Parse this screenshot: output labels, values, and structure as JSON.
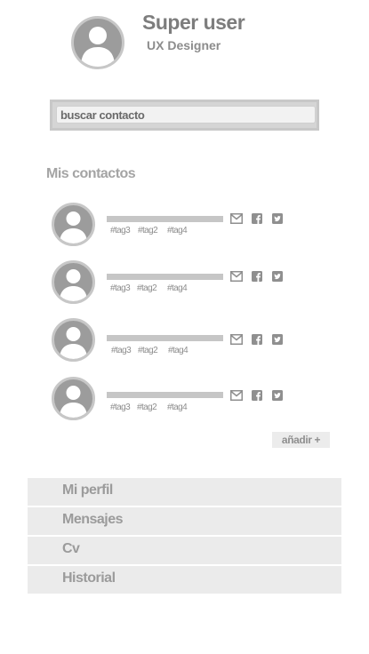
{
  "profile": {
    "name": "Super user",
    "role": "UX Designer",
    "avatar_icon": "user-silhouette-icon"
  },
  "search": {
    "value": "buscar contacto",
    "placeholder": "buscar contacto"
  },
  "contacts_section": {
    "title": "Mis contactos",
    "items": [
      {
        "tags": [
          "#tag3",
          "#tag2",
          "#tag4"
        ],
        "icons": [
          "mail-icon",
          "facebook-icon",
          "twitter-icon"
        ]
      },
      {
        "tags": [
          "#tag3",
          "#tag2",
          "#tag4"
        ],
        "icons": [
          "mail-icon",
          "facebook-icon",
          "twitter-icon"
        ]
      },
      {
        "tags": [
          "#tag3",
          "#tag2",
          "#tag4"
        ],
        "icons": [
          "mail-icon",
          "facebook-icon",
          "twitter-icon"
        ]
      },
      {
        "tags": [
          "#tag3",
          "#tag2",
          "#tag4"
        ],
        "icons": [
          "mail-icon",
          "facebook-icon",
          "twitter-icon"
        ]
      }
    ],
    "add_label": "añadir +"
  },
  "menu": {
    "items": [
      {
        "label": "Mi perfil"
      },
      {
        "label": "Mensajes"
      },
      {
        "label": "Cv"
      },
      {
        "label": "Historial"
      }
    ]
  },
  "colors": {
    "avatar_fill": "#9c9c9c",
    "avatar_ring": "#c7c7c7",
    "menu_bg": "#ebebeb",
    "text_gray": "#9b9b9b"
  }
}
